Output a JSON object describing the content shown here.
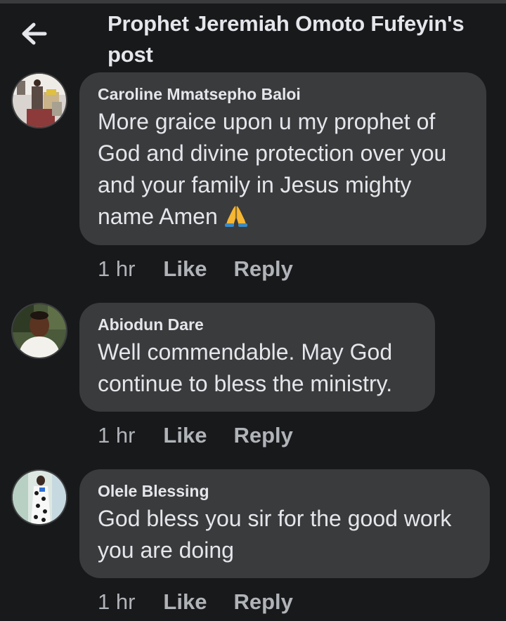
{
  "header": {
    "title": "Prophet Jeremiah Omoto Fufeyin's post",
    "back_icon": "arrow-left-icon"
  },
  "comments": [
    {
      "author": "Caroline Mmatsepho Baloi",
      "text": "More graice upon u my prophet of God and  divine protection over you and your family in Jesus mighty name Amen",
      "emoji": "🙏",
      "time": "1 hr",
      "like_label": "Like",
      "reply_label": "Reply"
    },
    {
      "author": "Abiodun Dare",
      "text": "Well commendable. May God continue to bless the ministry.",
      "time": "1 hr",
      "like_label": "Like",
      "reply_label": "Reply"
    },
    {
      "author": "Olele Blessing",
      "text": "God bless you sir for the good work you are doing",
      "time": "1 hr",
      "like_label": "Like",
      "reply_label": "Reply"
    }
  ],
  "colors": {
    "background": "#18191a",
    "bubble": "#3a3b3c",
    "primary_text": "#e4e6eb",
    "secondary_text": "#b0b3b8"
  }
}
